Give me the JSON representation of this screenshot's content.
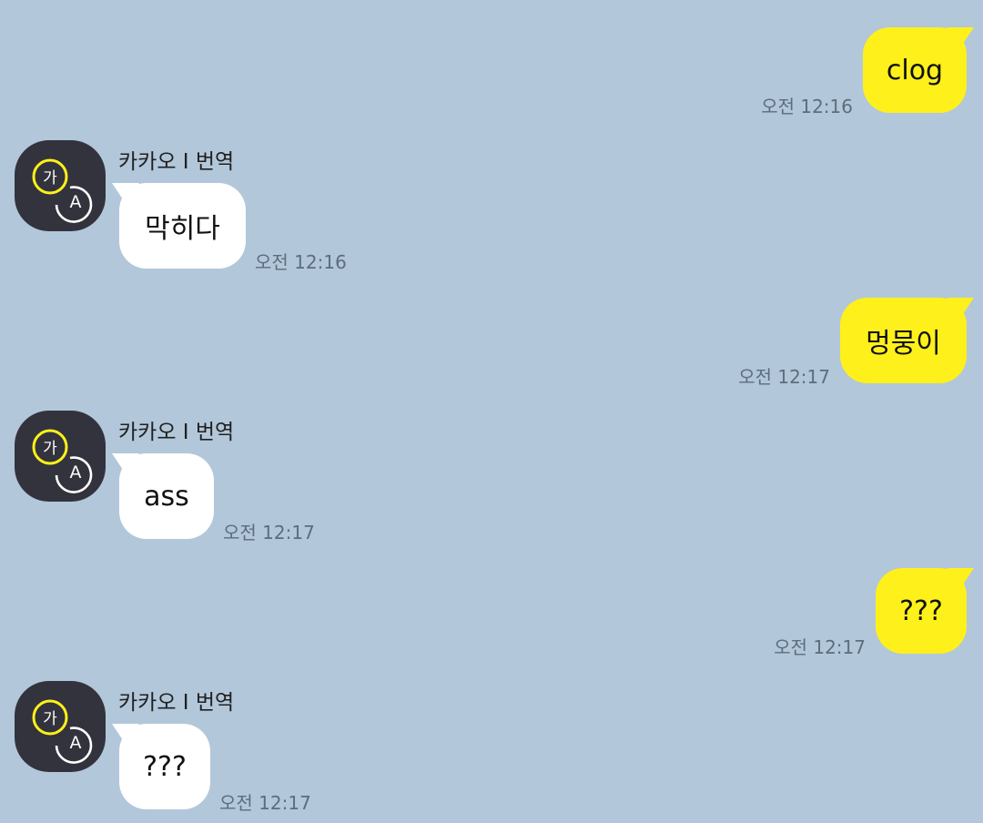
{
  "theme": {
    "background": "#b2c7da",
    "outgoing_bubble": "#fef01b",
    "incoming_bubble": "#ffffff",
    "avatar_bg": "#33333d",
    "avatar_accent": "#fef01b"
  },
  "messages": [
    {
      "direction": "out",
      "text": "clog",
      "time": "오전 12:16"
    },
    {
      "direction": "in",
      "sender": "카카오 I 번역",
      "avatar_icon": "translate-ga-a-icon",
      "text": "막히다",
      "time": "오전 12:16"
    },
    {
      "direction": "out",
      "text": "멍뭉이",
      "time": "오전 12:17"
    },
    {
      "direction": "in",
      "sender": "카카오 I 번역",
      "avatar_icon": "translate-ga-a-icon",
      "text": "ass",
      "time": "오전 12:17"
    },
    {
      "direction": "out",
      "text": "???",
      "time": "오전 12:17"
    },
    {
      "direction": "in",
      "sender": "카카오 I 번역",
      "avatar_icon": "translate-ga-a-icon",
      "text": "???",
      "time": "오전 12:17"
    }
  ]
}
